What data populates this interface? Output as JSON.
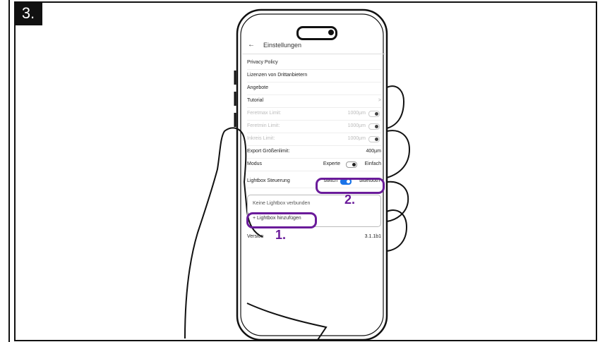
{
  "step_badge": "3.",
  "screen": {
    "title": "Einstellungen",
    "back_icon": "←",
    "rows": [
      {
        "label": "Privacy Policy"
      },
      {
        "label": "Lizenzen von Drittanbietern"
      },
      {
        "label": "Angebote"
      },
      {
        "label": "Tutorial",
        "chevron": ">"
      },
      {
        "label": "Feretmax Limit:",
        "value": "1000µm",
        "disabled": true
      },
      {
        "label": "Feretmin Limit:",
        "value": "1000µm",
        "disabled": true
      },
      {
        "label": "Inkreis Limit:",
        "value": "1000µm",
        "disabled": true
      },
      {
        "label": "Export Größenlimit:",
        "value": "400µm"
      },
      {
        "label": "Modus",
        "option_left": "Experte",
        "option_right": "Einfach"
      },
      {
        "label": "Lightbox Steuerung",
        "option_left": "switch",
        "option_right": "bluetooth"
      }
    ],
    "lightbox": {
      "empty_text": "Keine Lightbox verbunden",
      "add_label": "+ Lightbox hinzufügen"
    },
    "version": {
      "label": "Version",
      "value": "3.1.1b1"
    }
  },
  "annotations": {
    "one": "1.",
    "two": "2."
  },
  "colors": {
    "highlight": "#6a1b9a",
    "toggle_on": "#1a73e8"
  },
  "icons": {
    "back": "arrow-left-icon",
    "chevron": "chevron-right-icon"
  }
}
